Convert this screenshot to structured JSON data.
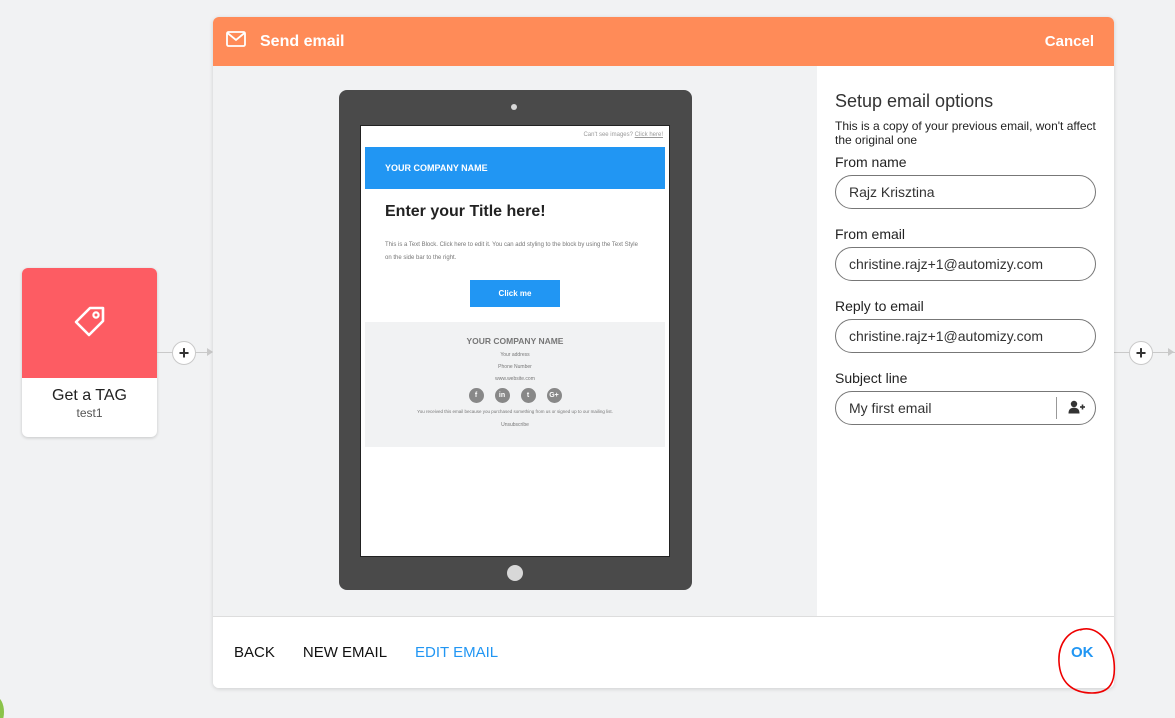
{
  "tag_node": {
    "title": "Get a TAG",
    "subtitle": "test1",
    "color": "#fd5c63"
  },
  "modal": {
    "title": "Send email",
    "cancel_label": "Cancel",
    "header_color": "#ff8b58"
  },
  "email_preview": {
    "cant_see_text": "Can't see images?",
    "cant_see_link": "Click here!",
    "company_name": "YOUR COMPANY NAME",
    "email_title": "Enter your Title here!",
    "body_text": "This is a Text Block. Click here to edit it. You can add styling to the block by using the Text Style on the side bar to the right.",
    "button_label": "Click me",
    "footer_company": "YOUR COMPANY NAME",
    "address": "Your address",
    "phone": "Phone Number",
    "website": "www.website.com",
    "social_icons": [
      "facebook-icon",
      "linkedin-icon",
      "twitter-icon",
      "google-plus-icon"
    ],
    "social_glyphs": [
      "f",
      "in",
      "t",
      "G+"
    ],
    "notice": "You received this email because you purchased something from us or signed up to our mailing list.",
    "unsubscribe": "Unsubscribe",
    "accent": "#2196f3"
  },
  "options": {
    "title": "Setup email options",
    "description": "This is a copy of your previous email, won't affect the original one",
    "from_name_label": "From name",
    "from_name_value": "Rajz Krisztina",
    "from_email_label": "From email",
    "from_email_value": "christine.rajz+1@automizy.com",
    "reply_label": "Reply to email",
    "reply_value": "christine.rajz+1@automizy.com",
    "subject_label": "Subject line",
    "subject_value": "My first email"
  },
  "footer": {
    "back_label": "BACK",
    "new_email_label": "NEW EMAIL",
    "edit_email_label": "EDIT EMAIL",
    "ok_label": "OK"
  }
}
